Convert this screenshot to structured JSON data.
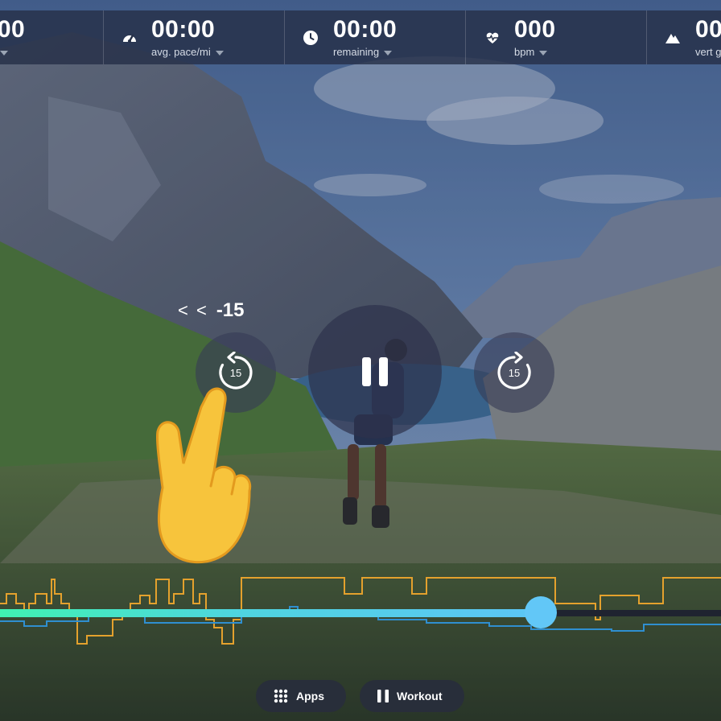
{
  "stats": [
    {
      "value": ".00",
      "label": "",
      "icon": "distance-icon"
    },
    {
      "value": "00:00",
      "label": "avg. pace/mi",
      "icon": "speedometer-icon"
    },
    {
      "value": "00:00",
      "label": "remaining",
      "icon": "clock-icon"
    },
    {
      "value": "000",
      "label": "bpm",
      "icon": "heart-rate-icon"
    },
    {
      "value": "00",
      "label": "vert g",
      "icon": "mountain-icon"
    }
  ],
  "playback": {
    "skip_indicator_chevrons": "< <",
    "skip_indicator_value": "-15",
    "rewind_seconds": "15",
    "forward_seconds": "15",
    "state_icon": "pause-icon"
  },
  "progress": {
    "fraction": 0.75,
    "accent": "#40f2b2",
    "scrubber_color": "#62c7f7"
  },
  "profile_colors": {
    "elevation": "#e4a12d",
    "pace": "#2f8fd0"
  },
  "bottom_nav": {
    "apps_label": "Apps",
    "workout_label": "Workout"
  }
}
